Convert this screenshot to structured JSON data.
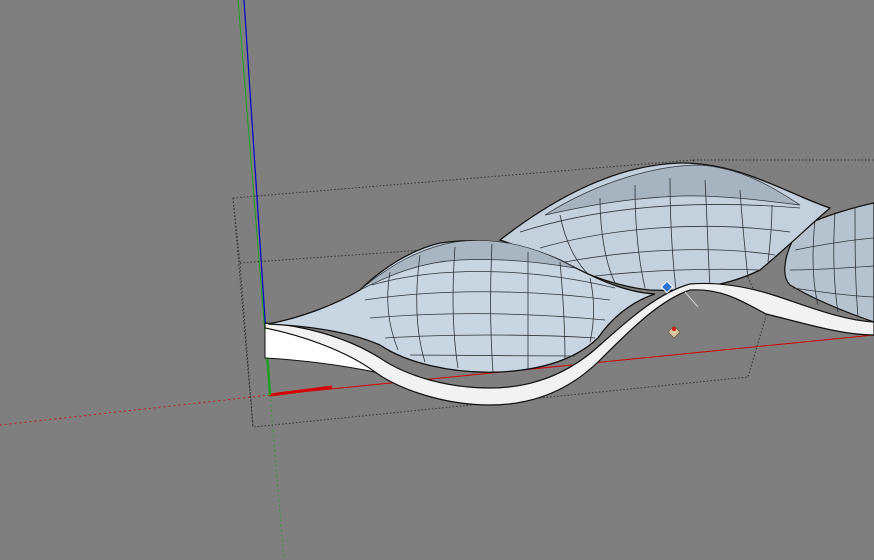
{
  "viewport": {
    "background": "#7f7f7f",
    "axes": {
      "x_color": "#d40000",
      "y_color": "#1f9f1f",
      "z_color": "#0000cc"
    },
    "model": {
      "shape": "wavy double-dome roof shell on curved side walls",
      "surface_color": "#c6d2df",
      "surface_shadow_color": "#8e9aa6",
      "wall_color": "#f2f2f2",
      "edge_color": "#101010",
      "grid_line_color": "#2f3336",
      "selected": true,
      "selection_box_color": "#333333"
    },
    "inference_point": {
      "type": "endpoint",
      "color": "#2f74d0"
    },
    "cursor_icon": "paint-bucket-cursor-icon",
    "scrollbars": false
  }
}
